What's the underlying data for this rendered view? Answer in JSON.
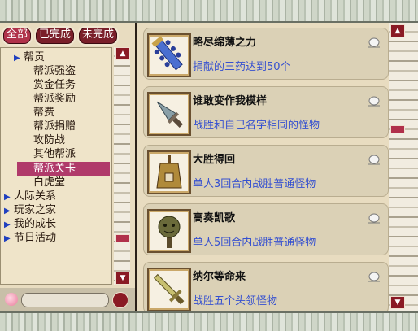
{
  "tabs": [
    {
      "label": "全部",
      "active": true
    },
    {
      "label": "已完成",
      "active": false
    },
    {
      "label": "未完成",
      "active": false
    }
  ],
  "nav": {
    "items": [
      {
        "label": "帮贡",
        "level": 1,
        "arrow": true,
        "selected": false
      },
      {
        "label": "帮派强盗",
        "level": 1,
        "arrow": false,
        "selected": false
      },
      {
        "label": "赏金任务",
        "level": 1,
        "arrow": false,
        "selected": false
      },
      {
        "label": "帮派奖励",
        "level": 1,
        "arrow": false,
        "selected": false
      },
      {
        "label": "帮费",
        "level": 1,
        "arrow": false,
        "selected": false
      },
      {
        "label": "帮派捐赠",
        "level": 1,
        "arrow": false,
        "selected": false
      },
      {
        "label": "攻防战",
        "level": 1,
        "arrow": false,
        "selected": false
      },
      {
        "label": "其他帮派",
        "level": 1,
        "arrow": false,
        "selected": false
      },
      {
        "label": "帮派关卡",
        "level": 1,
        "arrow": false,
        "selected": true
      },
      {
        "label": "白虎堂",
        "level": 1,
        "arrow": false,
        "selected": false
      },
      {
        "label": "人际关系",
        "level": 0,
        "arrow": true,
        "selected": false
      },
      {
        "label": "玩家之家",
        "level": 0,
        "arrow": true,
        "selected": false
      },
      {
        "label": "我的成长",
        "level": 0,
        "arrow": true,
        "selected": false
      },
      {
        "label": "节日活动",
        "level": 0,
        "arrow": true,
        "selected": false
      }
    ]
  },
  "achievements": [
    {
      "title": "略尽绵薄之力",
      "desc": "捐献的三药达到50个",
      "icon": "blue-spiked-weapon-icon"
    },
    {
      "title": "谁敢变作我模样",
      "desc": "战胜和自己名字相同的怪物",
      "icon": "dagger-icon"
    },
    {
      "title": "大胜得回",
      "desc": "单人3回合内战胜普通怪物",
      "icon": "bronze-bell-icon"
    },
    {
      "title": "高奏凯歌",
      "desc": "单人5回合内战胜普通怪物",
      "icon": "bronze-mask-icon"
    },
    {
      "title": "纳尔等命来",
      "desc": "战胜五个头领怪物",
      "icon": "sword-icon"
    }
  ]
}
